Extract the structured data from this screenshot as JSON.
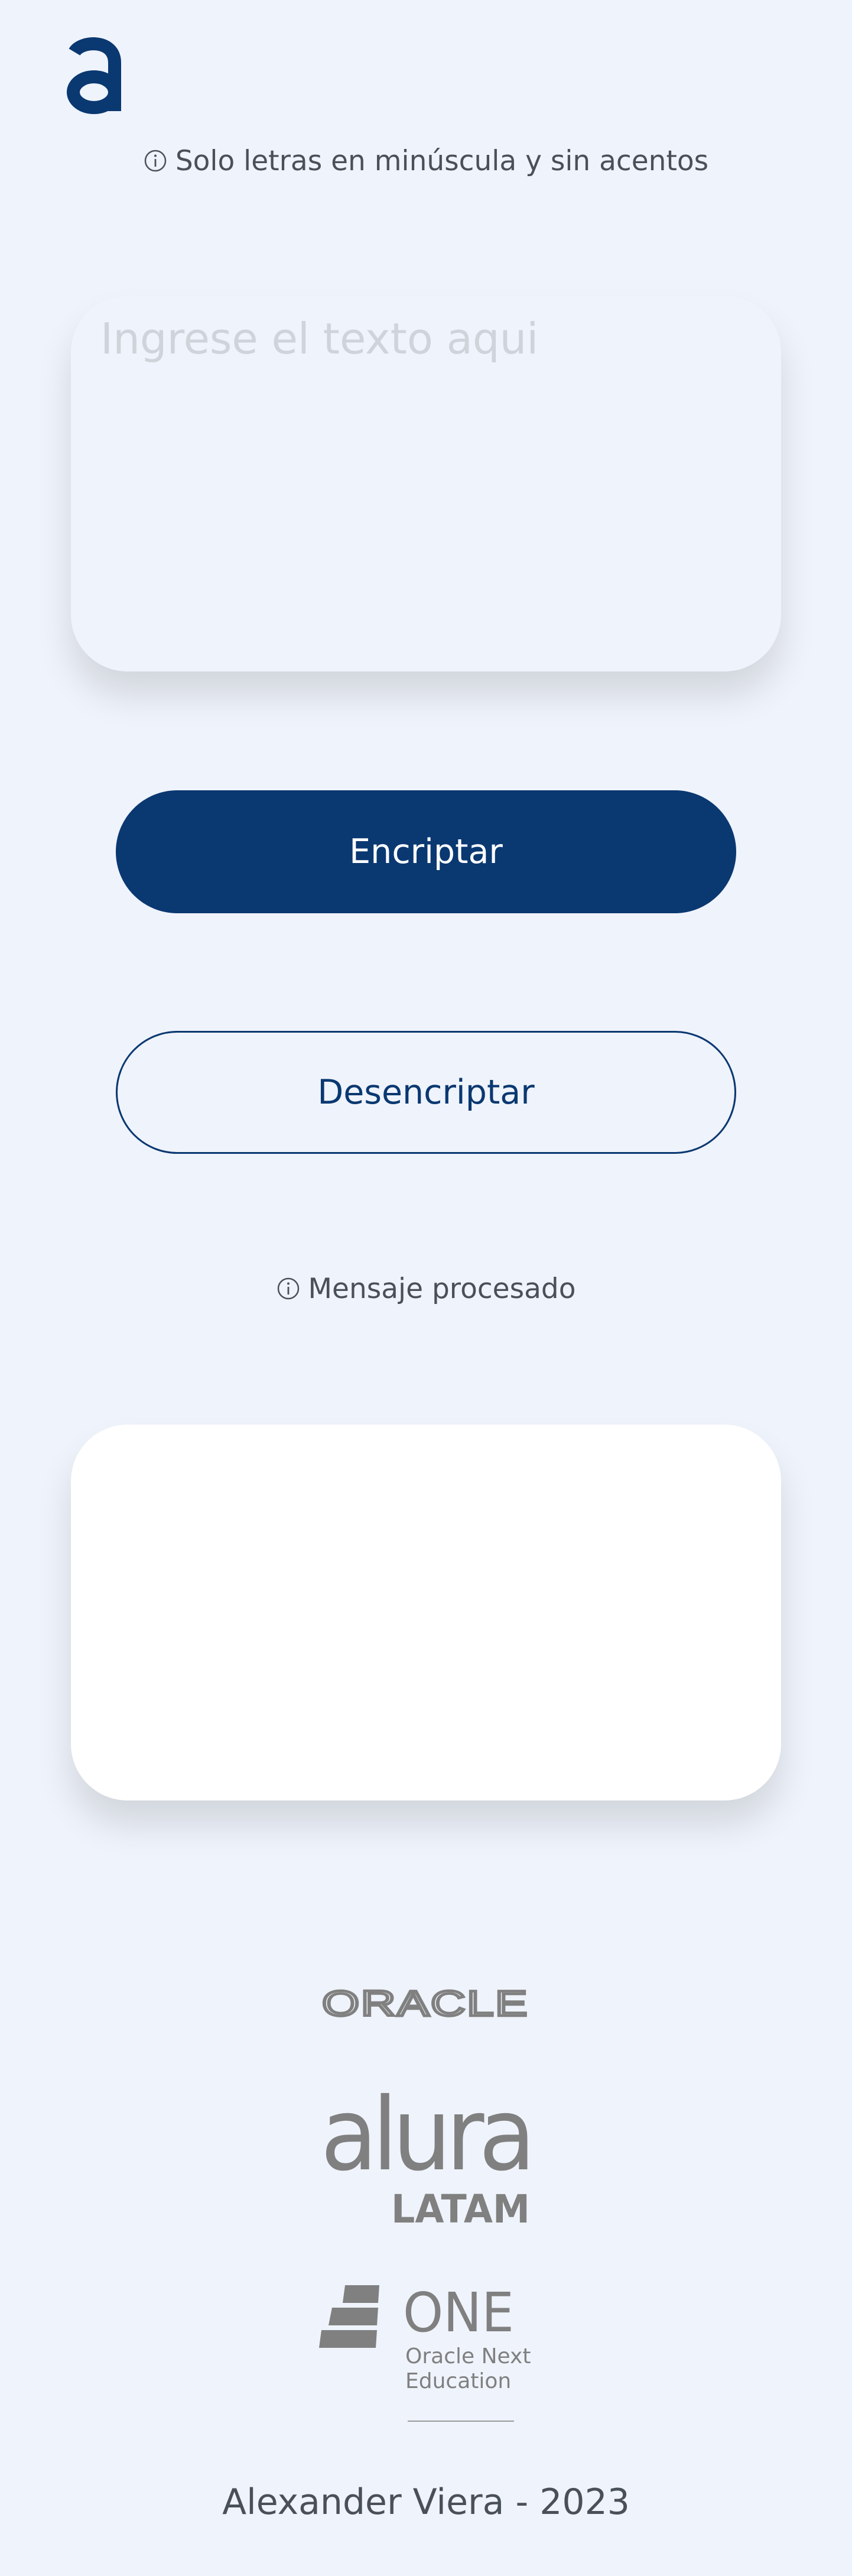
{
  "header": {
    "logo_icon": "alura-a-logo",
    "instruction": "Solo letras en minúscula y sin acentos",
    "instruction_icon": "info-icon"
  },
  "input": {
    "value": "",
    "placeholder": "Ingrese el texto aqui"
  },
  "buttons": {
    "encrypt_label": "Encriptar",
    "decrypt_label": "Desencriptar"
  },
  "output": {
    "status": "Mensaje procesado",
    "status_icon": "info-icon",
    "value": ""
  },
  "footer": {
    "sponsors": [
      {
        "name": "ORACLE"
      },
      {
        "name": "alura",
        "subtitle": "LATAM"
      },
      {
        "name": "ONE",
        "subtitle_line1": "Oracle Next",
        "subtitle_line2": "Education"
      }
    ],
    "credit": "Alexander Viera - 2023"
  },
  "colors": {
    "background": "#eff3fb",
    "primary": "#0a3871",
    "text": "#495057",
    "placeholder": "#ced4da",
    "logo_gray": "#808080",
    "card_output": "#ffffff"
  }
}
